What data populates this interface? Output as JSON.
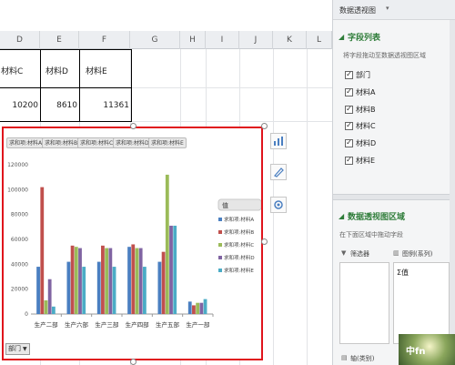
{
  "columns": [
    {
      "label": "D",
      "w": 44
    },
    {
      "label": "E",
      "w": 43
    },
    {
      "label": "F",
      "w": 56
    },
    {
      "label": "G",
      "w": 55
    },
    {
      "label": "H",
      "w": 28
    },
    {
      "label": "I",
      "w": 37
    },
    {
      "label": "J",
      "w": 37
    },
    {
      "label": "K",
      "w": 37
    },
    {
      "label": "L",
      "w": 28
    }
  ],
  "table": {
    "headers": [
      "材料C",
      "材料D",
      "材料E"
    ],
    "values": [
      "10200",
      "8610",
      "11361"
    ]
  },
  "chart_data": {
    "type": "bar",
    "field_buttons": [
      "求和项:材料A",
      "求和项:材料B",
      "求和项:材料C",
      "求和项:材料D",
      "求和项:材料E"
    ],
    "categories": [
      "生产二部",
      "生产六部",
      "生产三部",
      "生产四部",
      "生产五部",
      "生产一部"
    ],
    "series": [
      {
        "name": "求和项:材料A",
        "color": "#4a7fc1",
        "values": [
          38000,
          42000,
          42000,
          54000,
          42000,
          10000
        ]
      },
      {
        "name": "求和项:材料B",
        "color": "#c0504d",
        "values": [
          102000,
          55000,
          55000,
          56000,
          50000,
          7000
        ]
      },
      {
        "name": "求和项:材料C",
        "color": "#9bbb59",
        "values": [
          11000,
          54000,
          53000,
          53000,
          112000,
          9000
        ]
      },
      {
        "name": "求和项:材料D",
        "color": "#8064a2",
        "values": [
          28000,
          53000,
          53000,
          53000,
          71000,
          9000
        ]
      },
      {
        "name": "求和项:材料E",
        "color": "#4bacc6",
        "values": [
          6000,
          38000,
          38000,
          38000,
          71000,
          12000
        ]
      }
    ],
    "yticks": [
      "0",
      "20000",
      "40000",
      "60000",
      "80000",
      "100000",
      "120000"
    ],
    "ylim": [
      0,
      120000
    ],
    "legend_title": "值",
    "legend_position": "right",
    "axis_field_button": "部门",
    "grid": false
  },
  "panel": {
    "title": "数据透视图",
    "fields_header": "字段列表",
    "fields_hint": "将字段拖动至数据透视图区域",
    "fields": [
      "部门",
      "材料A",
      "材料B",
      "材料C",
      "材料D",
      "材料E"
    ],
    "areas_header": "数据透视图区域",
    "areas_hint": "在下面区域中拖动字段",
    "filter_label": "筛选器",
    "legend_label": "图例(系列)",
    "legend_value": "Σ值",
    "axis_label": "轴(类别)"
  },
  "watermark": "中fn"
}
